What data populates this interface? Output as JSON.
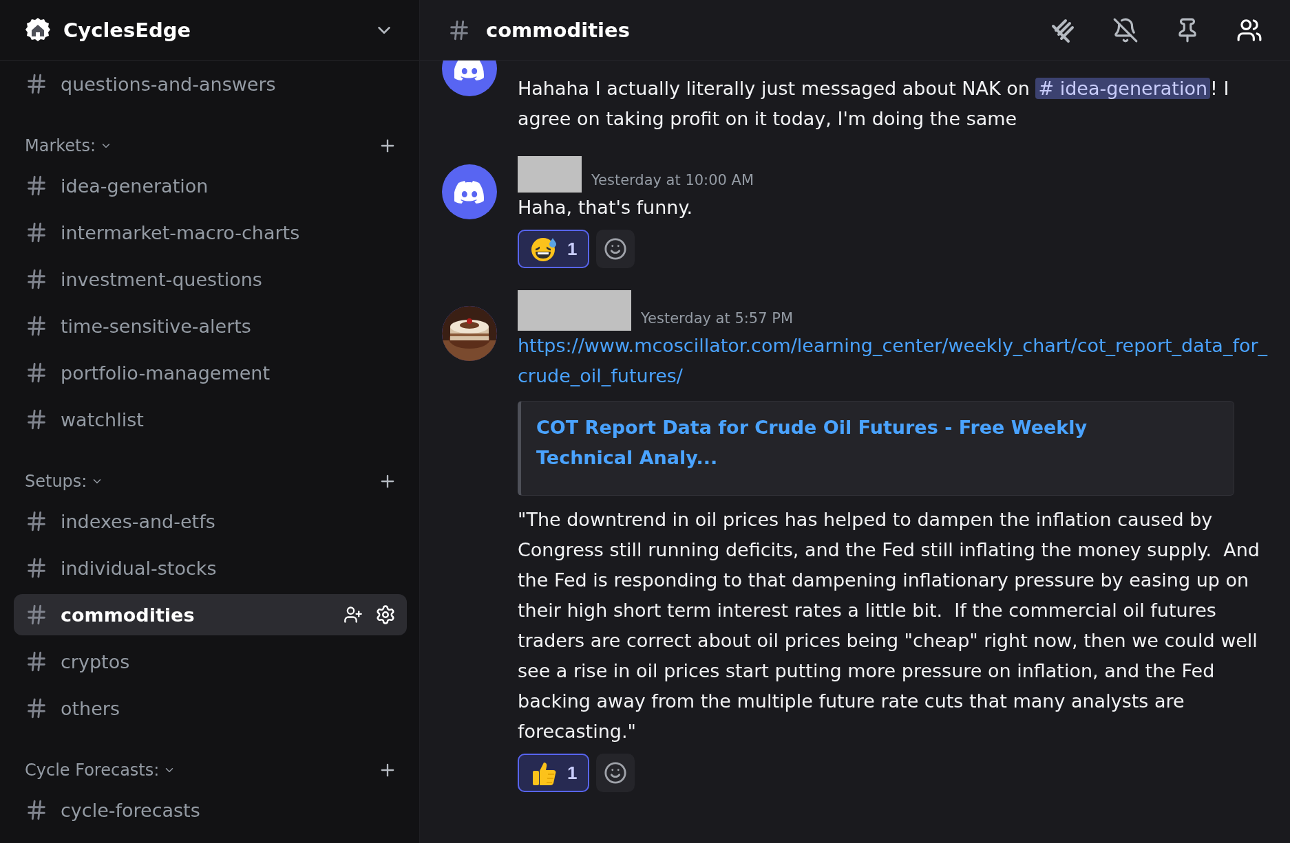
{
  "server": {
    "name": "CyclesEdge"
  },
  "sidebar": {
    "top_channels": [
      {
        "name": "questions-and-answers",
        "selected": false
      }
    ],
    "categories": [
      {
        "name": "Markets:",
        "channels": [
          {
            "name": "idea-generation",
            "selected": false
          },
          {
            "name": "intermarket-macro-charts",
            "selected": false
          },
          {
            "name": "investment-questions",
            "selected": false
          },
          {
            "name": "time-sensitive-alerts",
            "selected": false
          },
          {
            "name": "portfolio-management",
            "selected": false
          },
          {
            "name": "watchlist",
            "selected": false
          }
        ]
      },
      {
        "name": "Setups:",
        "channels": [
          {
            "name": "indexes-and-etfs",
            "selected": false
          },
          {
            "name": "individual-stocks",
            "selected": false
          },
          {
            "name": "commodities",
            "selected": true
          },
          {
            "name": "cryptos",
            "selected": false
          },
          {
            "name": "others",
            "selected": false
          }
        ]
      },
      {
        "name": "Cycle Forecasts:",
        "channels": [
          {
            "name": "cycle-forecasts",
            "selected": false
          }
        ]
      }
    ]
  },
  "header": {
    "channel": "commodities"
  },
  "messages": [
    {
      "avatar": {
        "kind": "discord"
      },
      "parts": [
        {
          "kind": "text",
          "text": "Hahaha I actually literally just messaged about NAK on "
        },
        {
          "kind": "mention",
          "text": "# idea-generation"
        },
        {
          "kind": "text",
          "text": "! I agree on taking profit on it today, I'm doing the same"
        }
      ]
    },
    {
      "avatar": {
        "kind": "discord"
      },
      "author": {
        "kind": "redacted-short"
      },
      "timestamp": "Yesterday at 10:00 AM",
      "parts": [
        {
          "kind": "text",
          "text": "Haha, that's funny."
        }
      ],
      "reactions": [
        {
          "kind": "sweat-smile",
          "count": "1",
          "selected": true
        }
      ]
    },
    {
      "author": {
        "kind": "redacted-long"
      },
      "timestamp": "Yesterday at 5:57 PM",
      "link": "https://www.mcoscillator.com/learning_center/weekly_chart/cot_report_data_for_crude_oil_futures/",
      "embed": {
        "title": "COT Report Data for Crude Oil Futures - Free Weekly Technical Analy..."
      },
      "parts": [
        {
          "kind": "text",
          "text": "\"The downtrend in oil prices has helped to dampen the inflation caused by Congress still running deficits, and the Fed still inflating the money supply.  And the Fed is responding to that dampening inflationary pressure by easing up on their high short term interest rates a little bit.  If the commercial oil futures traders are correct about oil prices being \"cheap\" right now, then we could well see a rise in oil prices start putting more pressure on inflation, and the Fed backing away from the multiple future rate cuts that many analysts are forecasting.\""
        }
      ],
      "reactions": [
        {
          "kind": "thumbs-up",
          "count": "1",
          "selected": true
        }
      ]
    }
  ]
}
